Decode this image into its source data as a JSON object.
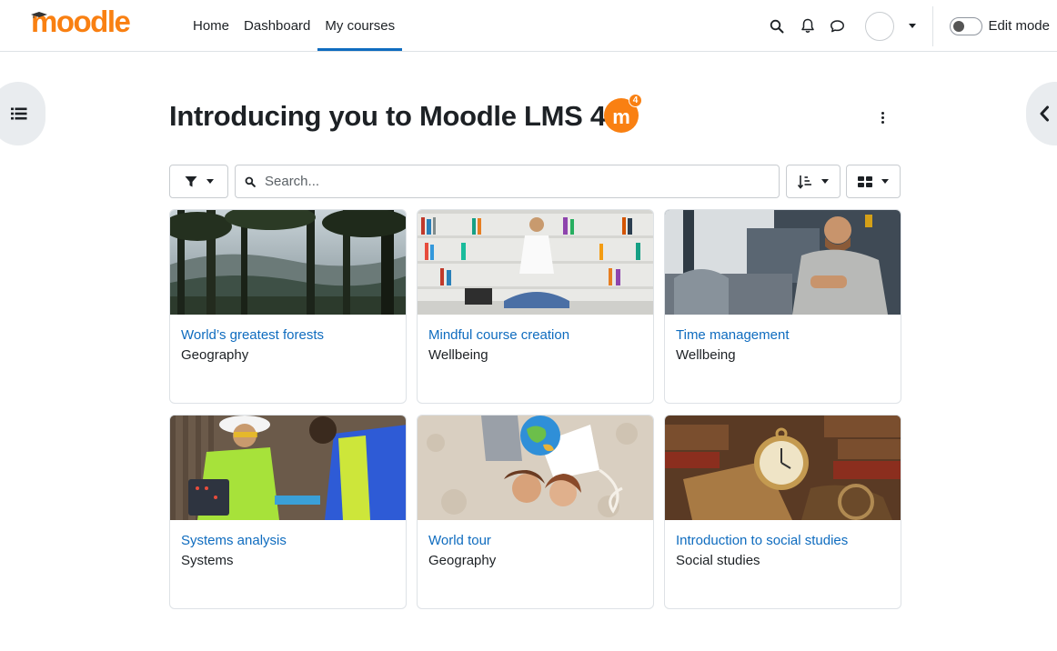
{
  "brand": {
    "name": "moodle",
    "color": "#f98012"
  },
  "nav": {
    "links": [
      {
        "label": "Home"
      },
      {
        "label": "Dashboard"
      },
      {
        "label": "My courses",
        "active": true
      }
    ],
    "right": {
      "icons": [
        "search-icon",
        "bell-icon",
        "chat-icon"
      ],
      "edit_mode_label": "Edit mode",
      "edit_mode_on": false
    }
  },
  "page": {
    "title": "Introducing you to Moodle LMS 4",
    "badge_letter": "m",
    "badge_number": "4"
  },
  "toolbar": {
    "search_placeholder": "Search...",
    "icons": [
      "filter-icon",
      "sort-icon",
      "grid-view-icon"
    ]
  },
  "courses": [
    {
      "title": "World’s greatest forests",
      "category": "Geography"
    },
    {
      "title": "Mindful course creation",
      "category": "Wellbeing"
    },
    {
      "title": "Time management",
      "category": "Wellbeing"
    },
    {
      "title": "Systems analysis",
      "category": "Systems"
    },
    {
      "title": "World tour",
      "category": "Geography"
    },
    {
      "title": "Introduction to social studies",
      "category": "Social studies"
    }
  ],
  "colors": {
    "link": "#0f6cbf",
    "accent": "#f98012",
    "border": "#dee2e6"
  }
}
